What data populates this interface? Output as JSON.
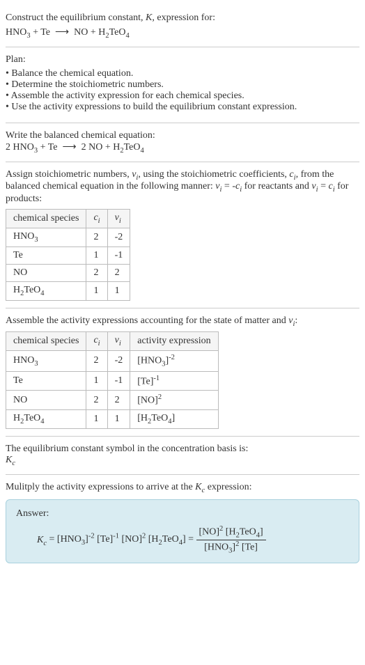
{
  "header": {
    "line1": "Construct the equilibrium constant, K, expression for:",
    "equation": "HNO₃ + Te ⟶ NO + H₂TeO₄"
  },
  "plan": {
    "title": "Plan:",
    "items": [
      "Balance the chemical equation.",
      "Determine the stoichiometric numbers.",
      "Assemble the activity expression for each chemical species.",
      "Use the activity expressions to build the equilibrium constant expression."
    ]
  },
  "balanced": {
    "title": "Write the balanced chemical equation:",
    "equation": "2 HNO₃ + Te ⟶ 2 NO + H₂TeO₄"
  },
  "stoich": {
    "intro": "Assign stoichiometric numbers, νᵢ, using the stoichiometric coefficients, cᵢ, from the balanced chemical equation in the following manner: νᵢ = -cᵢ for reactants and νᵢ = cᵢ for products:",
    "headers": [
      "chemical species",
      "cᵢ",
      "νᵢ"
    ],
    "rows": [
      [
        "HNO₃",
        "2",
        "-2"
      ],
      [
        "Te",
        "1",
        "-1"
      ],
      [
        "NO",
        "2",
        "2"
      ],
      [
        "H₂TeO₄",
        "1",
        "1"
      ]
    ]
  },
  "activity": {
    "intro": "Assemble the activity expressions accounting for the state of matter and νᵢ:",
    "headers": [
      "chemical species",
      "cᵢ",
      "νᵢ",
      "activity expression"
    ],
    "rows": [
      [
        "HNO₃",
        "2",
        "-2",
        "[HNO₃]⁻²"
      ],
      [
        "Te",
        "1",
        "-1",
        "[Te]⁻¹"
      ],
      [
        "NO",
        "2",
        "2",
        "[NO]²"
      ],
      [
        "H₂TeO₄",
        "1",
        "1",
        "[H₂TeO₄]"
      ]
    ]
  },
  "symbol": {
    "title": "The equilibrium constant symbol in the concentration basis is:",
    "value": "K_c"
  },
  "multiply": {
    "title": "Mulitply the activity expressions to arrive at the K_c expression:"
  },
  "answer": {
    "label": "Answer:",
    "lhs": "K_c = [HNO₃]⁻² [Te]⁻¹ [NO]² [H₂TeO₄] = ",
    "numerator": "[NO]² [H₂TeO₄]",
    "denominator": "[HNO₃]² [Te]"
  }
}
